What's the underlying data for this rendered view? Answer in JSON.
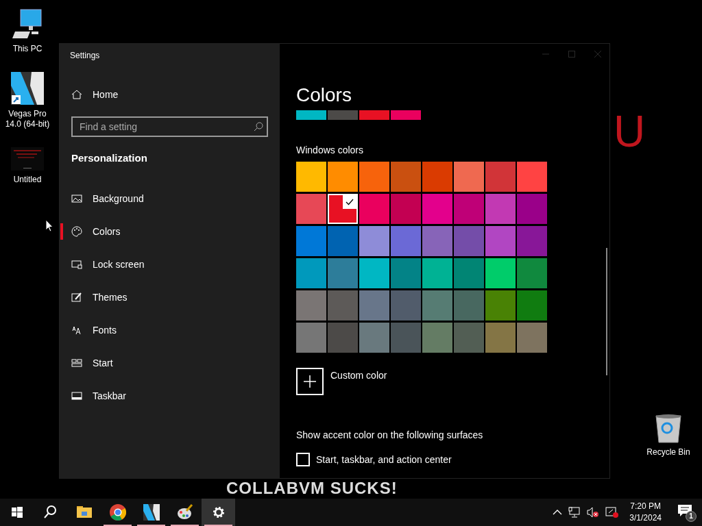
{
  "desktop": {
    "icons": [
      {
        "label": "This PC",
        "kind": "computer"
      },
      {
        "label": "Vegas Pro 14.0 (64-bit)",
        "kind": "vegas"
      },
      {
        "label": "Untitled",
        "kind": "thumbnail"
      },
      {
        "label": "Recycle Bin",
        "kind": "recycle"
      }
    ],
    "wallpaper_texts": [
      "U",
      "COLLABVM SUCKS!"
    ]
  },
  "window": {
    "title": "Settings",
    "sidebar": {
      "home": "Home",
      "search": {
        "placeholder": "Find a setting"
      },
      "section": "Personalization",
      "items": [
        {
          "label": "Background",
          "kind": "picture",
          "selected": false
        },
        {
          "label": "Colors",
          "kind": "palette",
          "selected": true
        },
        {
          "label": "Lock screen",
          "kind": "monitor",
          "selected": false
        },
        {
          "label": "Themes",
          "kind": "pen",
          "selected": false
        },
        {
          "label": "Fonts",
          "kind": "letters",
          "selected": false
        },
        {
          "label": "Start",
          "kind": "tiles",
          "selected": false
        },
        {
          "label": "Taskbar",
          "kind": "bar",
          "selected": false
        }
      ]
    },
    "content": {
      "heading": "Colors",
      "recent_colors": [
        {
          "color": "#00b7c3"
        },
        {
          "color": "#4c4a48"
        },
        {
          "color": "#e81123"
        },
        {
          "color": "#ea005e"
        }
      ],
      "swatches_label": "Windows colors",
      "swatches": [
        {
          "color": "#ffb900",
          "selected": false
        },
        {
          "color": "#ff8c00",
          "selected": false
        },
        {
          "color": "#f7630c",
          "selected": false
        },
        {
          "color": "#ca5010",
          "selected": false
        },
        {
          "color": "#da3b01",
          "selected": false
        },
        {
          "color": "#ef6950",
          "selected": false
        },
        {
          "color": "#d13438",
          "selected": false
        },
        {
          "color": "#ff4343",
          "selected": false
        },
        {
          "color": "#e74856",
          "selected": false
        },
        {
          "color": "#e81123",
          "selected": true
        },
        {
          "color": "#ea005e",
          "selected": false
        },
        {
          "color": "#c30052",
          "selected": false
        },
        {
          "color": "#e3008c",
          "selected": false
        },
        {
          "color": "#bf0077",
          "selected": false
        },
        {
          "color": "#c239b3",
          "selected": false
        },
        {
          "color": "#9a0089",
          "selected": false
        },
        {
          "color": "#0078d7",
          "selected": false
        },
        {
          "color": "#0063b1",
          "selected": false
        },
        {
          "color": "#8e8cd8",
          "selected": false
        },
        {
          "color": "#6b69d6",
          "selected": false
        },
        {
          "color": "#8764b8",
          "selected": false
        },
        {
          "color": "#744da9",
          "selected": false
        },
        {
          "color": "#b146c2",
          "selected": false
        },
        {
          "color": "#881798",
          "selected": false
        },
        {
          "color": "#0099bc",
          "selected": false
        },
        {
          "color": "#2d7d9a",
          "selected": false
        },
        {
          "color": "#00b7c3",
          "selected": false
        },
        {
          "color": "#038387",
          "selected": false
        },
        {
          "color": "#00b294",
          "selected": false
        },
        {
          "color": "#018574",
          "selected": false
        },
        {
          "color": "#00cc6a",
          "selected": false
        },
        {
          "color": "#10893e",
          "selected": false
        },
        {
          "color": "#7a7574",
          "selected": false
        },
        {
          "color": "#5d5a58",
          "selected": false
        },
        {
          "color": "#68768a",
          "selected": false
        },
        {
          "color": "#515c6b",
          "selected": false
        },
        {
          "color": "#567c73",
          "selected": false
        },
        {
          "color": "#486860",
          "selected": false
        },
        {
          "color": "#498205",
          "selected": false
        },
        {
          "color": "#107c10",
          "selected": false
        },
        {
          "color": "#767676",
          "selected": false
        },
        {
          "color": "#4c4a48",
          "selected": false
        },
        {
          "color": "#69797e",
          "selected": false
        },
        {
          "color": "#4a5459",
          "selected": false
        },
        {
          "color": "#647c64",
          "selected": false
        },
        {
          "color": "#525e54",
          "selected": false
        },
        {
          "color": "#847545",
          "selected": false
        },
        {
          "color": "#7e735f",
          "selected": false
        }
      ],
      "custom_color": "Custom color",
      "surfaces_label": "Show accent color on the following surfaces",
      "checkbox": {
        "label": "Start, taskbar, and action center",
        "checked": false
      }
    }
  },
  "taskbar": {
    "apps": [
      {
        "kind": "start",
        "running": false,
        "selected": false
      },
      {
        "kind": "search",
        "running": false,
        "selected": false
      },
      {
        "kind": "folder",
        "running": false,
        "selected": false
      },
      {
        "kind": "chrome",
        "running": true,
        "selected": false
      },
      {
        "kind": "vegas",
        "running": true,
        "selected": false
      },
      {
        "kind": "paint",
        "running": true,
        "selected": false
      },
      {
        "kind": "gear",
        "running": true,
        "selected": true
      }
    ],
    "time": "7:20 PM",
    "date": "3/1/2024",
    "notifications": "1"
  }
}
